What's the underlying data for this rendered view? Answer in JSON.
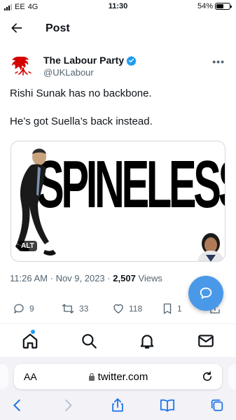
{
  "status_bar": {
    "carrier": "EE",
    "network": "4G",
    "time": "11:30",
    "battery": "54%",
    "battery_level": 0.54
  },
  "header": {
    "title": "Post",
    "back_icon": "arrow-left-icon"
  },
  "author": {
    "name": "The Labour Party",
    "handle": "@UKLabour",
    "verified": true,
    "avatar_icon": "labour-rose-logo"
  },
  "tweet": {
    "lines": [
      "Rishi Sunak has no backbone.",
      "He’s got Suella’s back instead."
    ]
  },
  "media": {
    "word": "SPINELESS",
    "alt_badge": "ALT"
  },
  "meta": {
    "time": "11:26 AM",
    "separator": "·",
    "date": "Nov 9, 2023",
    "views_count": "2,507",
    "views_label": "Views"
  },
  "actions": {
    "replies": "9",
    "reposts": "33",
    "likes": "118",
    "bookmarks": "1"
  },
  "tabbar": {
    "items": [
      "home-icon",
      "search-icon",
      "notifications-icon",
      "messages-icon"
    ]
  },
  "browser": {
    "text_size_label": "AA",
    "url": "twitter.com"
  },
  "colors": {
    "accent": "#1d9bf0",
    "fab": "#4a99e9",
    "labour_red": "#d50000",
    "muted_text": "#536471"
  }
}
